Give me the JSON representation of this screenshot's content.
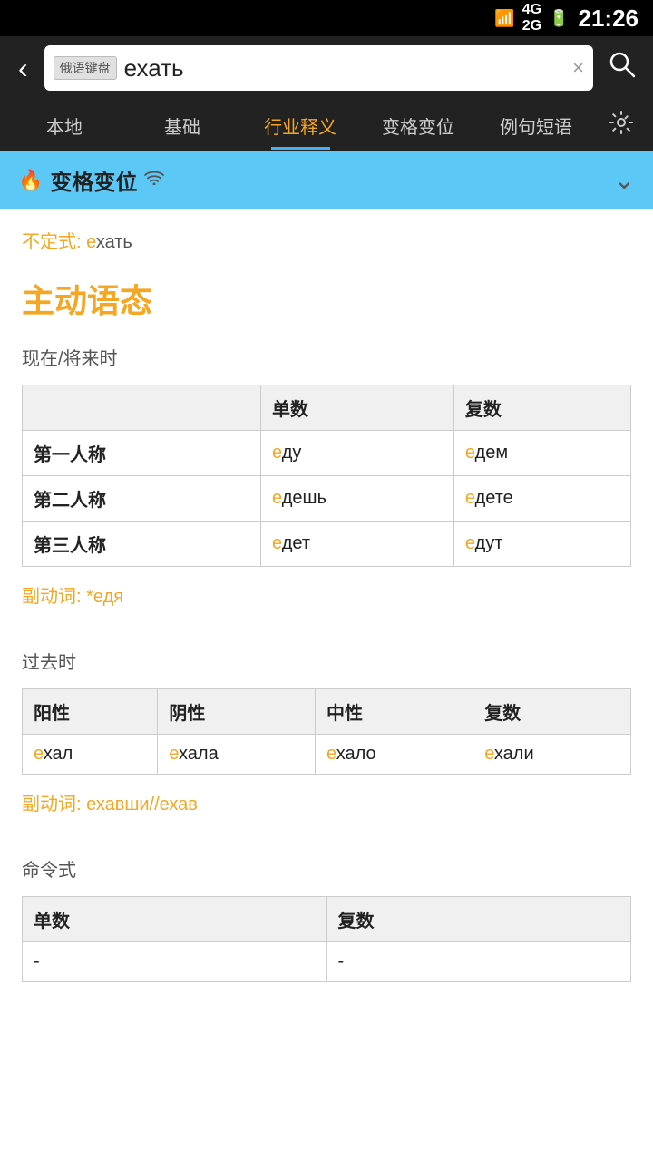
{
  "statusBar": {
    "time": "21:26",
    "icons": [
      "wifi",
      "4g/2g",
      "battery"
    ]
  },
  "searchBar": {
    "backLabel": "‹",
    "keyboardBadge": "俄语键盘",
    "searchValue": "ехать",
    "clearIcon": "×",
    "searchIcon": "⌕"
  },
  "navTabs": [
    {
      "id": "local",
      "label": "本地"
    },
    {
      "id": "basic",
      "label": "基础"
    },
    {
      "id": "industry",
      "label": "行业释义",
      "active": true
    },
    {
      "id": "conjugation",
      "label": "变格变位"
    },
    {
      "id": "example",
      "label": "例句短语"
    }
  ],
  "settingsIcon": "⚙",
  "banner": {
    "fireIcon": "🔥",
    "title": "变格变位",
    "wifiIcon": "📶",
    "chevronIcon": "⌄"
  },
  "content": {
    "indefinite": {
      "label": "不定式:",
      "prefix": "",
      "eHighlight": "е",
      "rest": "хать"
    },
    "voiceTitle": "主动语态",
    "presentFuture": {
      "label": "现在/将来时",
      "headers": [
        "",
        "单数",
        "复数"
      ],
      "rows": [
        {
          "rowHeader": "第一人称",
          "singular": {
            "e": "е",
            "rest": "ду"
          },
          "plural": {
            "e": "е",
            "rest": "дем"
          }
        },
        {
          "rowHeader": "第二人称",
          "singular": {
            "e": "е",
            "rest": "дешь"
          },
          "plural": {
            "e": "е",
            "rest": "дете"
          }
        },
        {
          "rowHeader": "第三人称",
          "singular": {
            "e": "е",
            "rest": "дет"
          },
          "plural": {
            "e": "е",
            "rest": "дут"
          }
        }
      ],
      "participle": {
        "label": "副动词:",
        "text": "*еДя",
        "eHighlight": "е",
        "rest": "Дя",
        "prefix": "*"
      }
    },
    "past": {
      "label": "过去时",
      "headers": [
        "阳性",
        "阴性",
        "中性",
        "复数"
      ],
      "row": [
        {
          "e": "е",
          "rest": "хал"
        },
        {
          "e": "е",
          "rest": "хала"
        },
        {
          "e": "е",
          "rest": "хало"
        },
        {
          "e": "е",
          "rest": "хали"
        }
      ],
      "participle": {
        "label": "副动词:",
        "text": "ехавши//ехав",
        "e1": "е",
        "rest1": "хавши//",
        "e2": "е",
        "rest2": "хав"
      }
    },
    "imperative": {
      "label": "命令式",
      "headers": [
        "单数",
        "复数"
      ],
      "rows": [
        {
          "singular": "-",
          "plural": "-"
        }
      ]
    }
  }
}
